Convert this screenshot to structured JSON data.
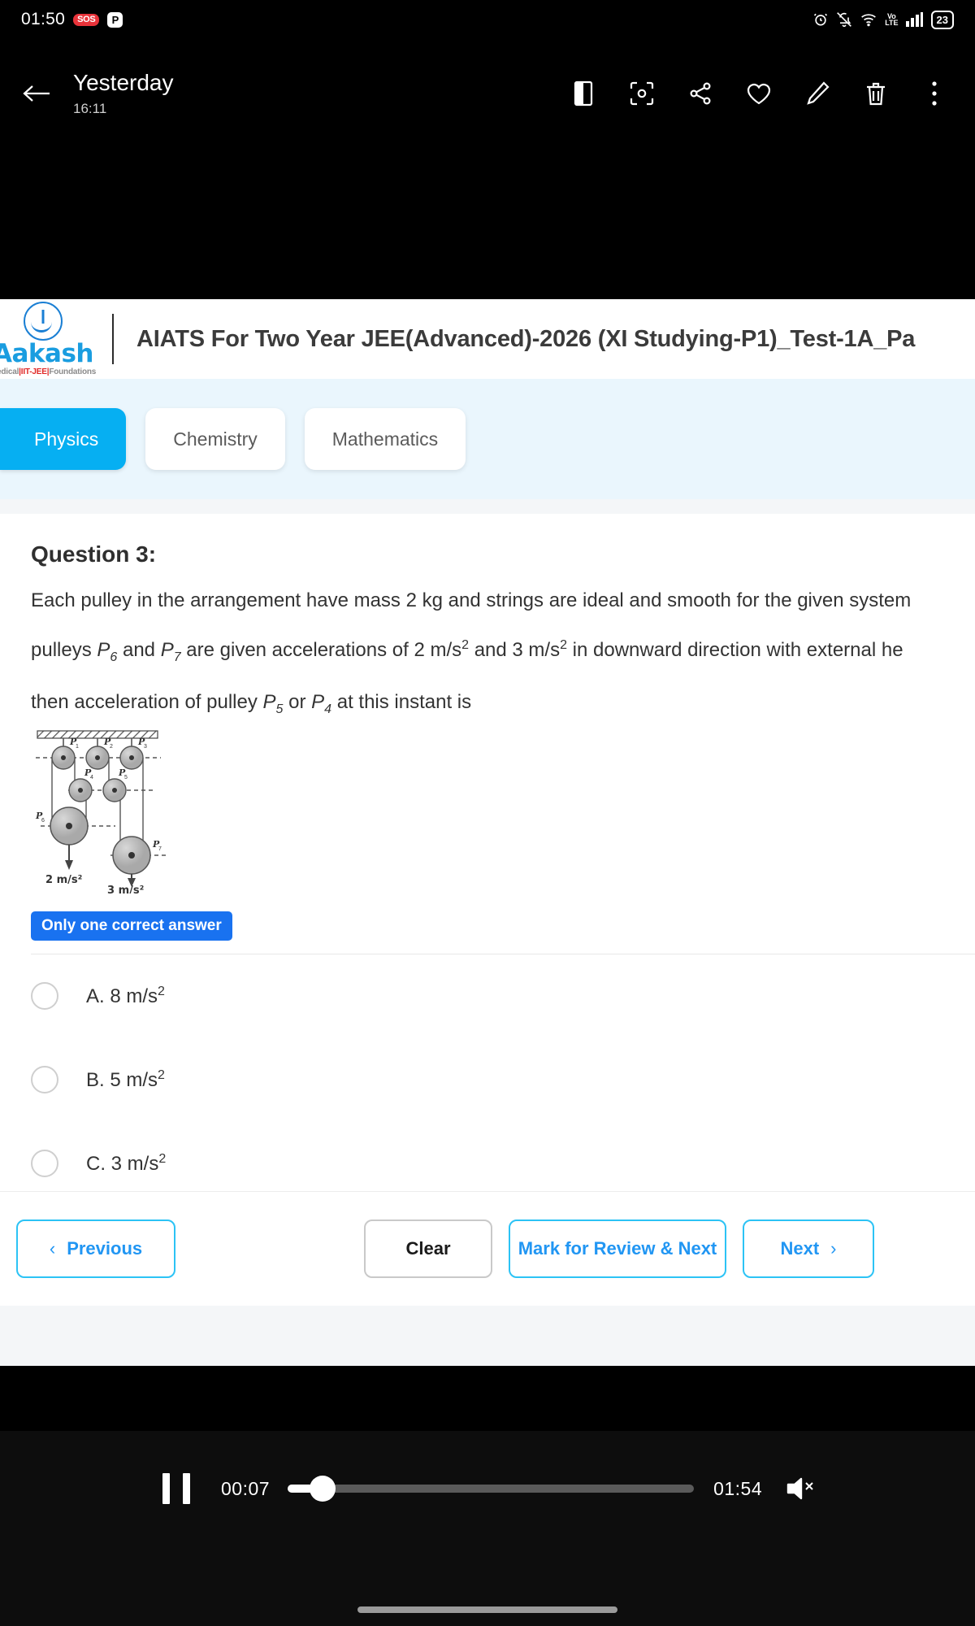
{
  "status_bar": {
    "time": "01:50",
    "sos_badge": "SOS",
    "p_badge": "P",
    "volte_top": "Vo",
    "volte_bottom": "LTE",
    "battery": "23",
    "icons": [
      "alarm-icon",
      "bell-off-icon",
      "wifi-icon",
      "volte-icon",
      "signal-icon",
      "battery-icon"
    ]
  },
  "toolbar": {
    "title": "Yesterday",
    "subtitle": "16:11",
    "back_icon": "back-arrow-icon",
    "actions": [
      "split-view-icon",
      "lens-scan-icon",
      "share-icon",
      "favorite-heart-icon",
      "edit-pencil-icon",
      "delete-trash-icon",
      "more-options-icon"
    ]
  },
  "page": {
    "logo": {
      "word": "Aakash",
      "tagline_1": "Medical",
      "tagline_2": "IIT-JEE",
      "tagline_3": "Foundations"
    },
    "header_title": "AIATS For Two Year JEE(Advanced)-2026 (XI Studying-P1)_Test-1A_Pa",
    "tabs": [
      {
        "label": "Physics",
        "active": true
      },
      {
        "label": "Chemistry",
        "active": false
      },
      {
        "label": "Mathematics",
        "active": false
      }
    ],
    "question": {
      "number_label": "Question 3:",
      "line1": "Each pulley in the arrangement have mass 2 kg and strings are ideal and smooth for the given system",
      "line2_a": "pulleys ",
      "line2_p6": "P",
      "line2_p6_sub": "6",
      "line2_b": " and ",
      "line2_p7": "P",
      "line2_p7_sub": "7",
      "line2_c": " are given accelerations of 2 m/s",
      "line2_sup1": "2",
      "line2_d": " and 3 m/s",
      "line2_sup2": "2",
      "line2_e": " in downward direction with external he",
      "line3_a": "then acceleration of pulley ",
      "line3_p5": "P",
      "line3_p5_sub": "5",
      "line3_b": " or ",
      "line3_p4": "P",
      "line3_p4_sub": "4",
      "line3_c": " at this instant is",
      "badge": "Only one correct answer"
    },
    "figure": {
      "name": "pulley-system-diagram",
      "pulley_labels": [
        "P1",
        "P2",
        "P3",
        "P4",
        "P5",
        "P6",
        "P7"
      ],
      "accel_left": "2 m/s²",
      "accel_right": "3 m/s²"
    },
    "options": [
      {
        "id": "A",
        "text": "A. 8 m/s",
        "sup": "2",
        "selected": false
      },
      {
        "id": "B",
        "text": "B. 5 m/s",
        "sup": "2",
        "selected": false
      },
      {
        "id": "C",
        "text": "C. 3 m/s",
        "sup": "2",
        "selected": false
      }
    ],
    "nav": {
      "previous": "Previous",
      "previous_chevron": "‹",
      "clear": "Clear",
      "mark_review_next": "Mark for Review & Next",
      "next": "Next",
      "next_chevron": "›"
    }
  },
  "player": {
    "pause_icon": "pause-icon",
    "elapsed": "00:07",
    "duration": "01:54",
    "mute_icon": "volume-mute-icon",
    "progress_percent": 7
  },
  "colors": {
    "accent_blue": "#06aff2",
    "link_blue": "#2196f3",
    "badge_blue": "#1972f0",
    "tabs_bg": "#eaf6fd",
    "grey_strip": "#f4f6f8"
  }
}
